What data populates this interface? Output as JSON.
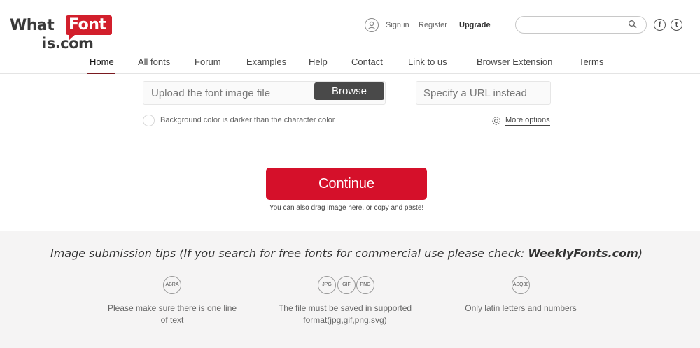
{
  "logo": {
    "what": "What",
    "font": "Font",
    "is_com": "is.com",
    "brand_red": "#d21f2c"
  },
  "header": {
    "sign_in": "Sign in",
    "register": "Register",
    "upgrade": "Upgrade",
    "search_placeholder": "",
    "social": {
      "facebook": "f",
      "twitter": "t"
    }
  },
  "nav": {
    "items": [
      "Home",
      "All fonts",
      "Forum",
      "Examples",
      "Help",
      "Contact",
      "Link to us",
      "Browser Extension",
      "Terms"
    ],
    "active": "Home"
  },
  "upload": {
    "placeholder": "Upload the font image file",
    "browse_label": "Browse",
    "url_placeholder": "Specify a URL instead"
  },
  "options": {
    "bg_darker_label": "Background color is darker than the character color",
    "more_options": "More options"
  },
  "actions": {
    "continue_label": "Continue",
    "drag_hint": "You can also drag image here, or copy and paste!"
  },
  "tips": {
    "title_prefix": "Image submission tips (If you search for free fonts for commercial use please check: ",
    "title_link": "WeeklyFonts.com",
    "title_suffix": ")",
    "items": [
      {
        "icons": [
          "ABRA"
        ],
        "line1": "Please make sure there is one line",
        "line2": "of text"
      },
      {
        "icons": [
          "JPG",
          "GIF",
          "PNG"
        ],
        "line1": "The file must be saved in supported",
        "line2": "format(jpg,gif,png,svg)"
      },
      {
        "icons": [
          "ASQ38"
        ],
        "line1": "Only latin letters and numbers",
        "line2": ""
      }
    ]
  },
  "colors": {
    "continue": "#d5102a",
    "browse": "#494949",
    "tips_bg": "#f5f4f4"
  }
}
